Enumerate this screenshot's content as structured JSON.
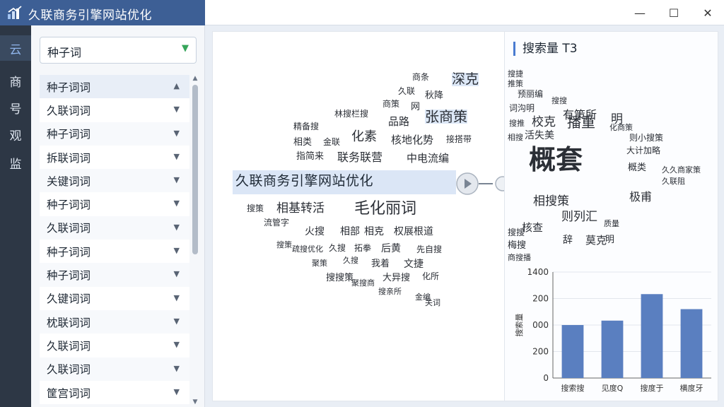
{
  "window": {
    "title": "久联商务引擎网站优化",
    "minimize": "—",
    "maximize": "☐",
    "close": "✕"
  },
  "rail": {
    "items": [
      "云",
      "商",
      "号",
      "观",
      "监"
    ]
  },
  "sidebar": {
    "select_value": "种子词",
    "items": [
      {
        "label": "种子词词",
        "chevron": "up"
      },
      {
        "label": "久联词词",
        "chevron": "down"
      },
      {
        "label": "种子词词",
        "chevron": "down"
      },
      {
        "label": "拆联词词",
        "chevron": "down"
      },
      {
        "label": "关键词词",
        "chevron": "down"
      },
      {
        "label": "种子词词",
        "chevron": "down"
      },
      {
        "label": "久联词词",
        "chevron": "down"
      },
      {
        "label": "种子词词",
        "chevron": "down"
      },
      {
        "label": "种子词词",
        "chevron": "down"
      },
      {
        "label": "久键词词",
        "chevron": "down"
      },
      {
        "label": "枕联词词",
        "chevron": "down"
      },
      {
        "label": "久联词词",
        "chevron": "down"
      },
      {
        "label": "久联词词",
        "chevron": "down"
      },
      {
        "label": "筐宫词词",
        "chevron": "down"
      }
    ]
  },
  "cloud": {
    "main_term": "久联商务引擎网站优化",
    "words": [
      {
        "text": "深克",
        "size": 19,
        "hl": true
      },
      {
        "text": "商条",
        "size": 12
      },
      {
        "text": "久联",
        "size": 12
      },
      {
        "text": "秋降",
        "size": 13
      },
      {
        "text": "商策",
        "size": 12
      },
      {
        "text": "网",
        "size": 13
      },
      {
        "text": "品路",
        "size": 15
      },
      {
        "text": "张商策",
        "size": 20,
        "hl": true
      },
      {
        "text": "林搜栏搜",
        "size": 12
      },
      {
        "text": "精备搜",
        "size": 12
      },
      {
        "text": "化素",
        "size": 18
      },
      {
        "text": "核地化势",
        "size": 15
      },
      {
        "text": "接搭带",
        "size": 12
      },
      {
        "text": "相类",
        "size": 13
      },
      {
        "text": "金联",
        "size": 12
      },
      {
        "text": "指简来",
        "size": 13
      },
      {
        "text": "联务联营",
        "size": 16
      },
      {
        "text": "中电流编",
        "size": 15
      },
      {
        "text": "搜策",
        "size": 12
      },
      {
        "text": "相基转活",
        "size": 17
      },
      {
        "text": "毛化丽词",
        "size": 22
      },
      {
        "text": "流管字",
        "size": 12
      },
      {
        "text": "火搜",
        "size": 14
      },
      {
        "text": "相部",
        "size": 14
      },
      {
        "text": "相克",
        "size": 14
      },
      {
        "text": "权展根道",
        "size": 14
      },
      {
        "text": "搜策",
        "size": 11
      },
      {
        "text": "疏搜优化",
        "size": 11
      },
      {
        "text": "久搜",
        "size": 12
      },
      {
        "text": "拓拳",
        "size": 12
      },
      {
        "text": "后黄",
        "size": 14
      },
      {
        "text": "先自搜",
        "size": 12
      },
      {
        "text": "聚策",
        "size": 11
      },
      {
        "text": "久搜",
        "size": 11
      },
      {
        "text": "我着",
        "size": 13
      },
      {
        "text": "文捷",
        "size": 14
      },
      {
        "text": "搜搜策",
        "size": 13
      },
      {
        "text": "大异搜",
        "size": 13
      },
      {
        "text": "化所",
        "size": 12
      },
      {
        "text": "聚搜商",
        "size": 11
      },
      {
        "text": "搜亲所",
        "size": 11
      },
      {
        "text": "金编",
        "size": 11
      },
      {
        "text": "关词",
        "size": 11
      }
    ]
  },
  "right_panel": {
    "title": "搜索量 T3",
    "cloud": [
      {
        "text": "搜捷",
        "size": 11
      },
      {
        "text": "推策",
        "size": 11
      },
      {
        "text": "预丽编",
        "size": 12
      },
      {
        "text": "搜搜",
        "size": 11
      },
      {
        "text": "词沟明",
        "size": 12
      },
      {
        "text": "有策所",
        "size": 16
      },
      {
        "text": "搜推",
        "size": 11
      },
      {
        "text": "校克",
        "size": 17
      },
      {
        "text": "播重",
        "size": 20
      },
      {
        "text": "明",
        "size": 17
      },
      {
        "text": "化商策",
        "size": 11
      },
      {
        "text": "相搜",
        "size": 11
      },
      {
        "text": "活失美",
        "size": 14
      },
      {
        "text": "则小搜策",
        "size": 12
      },
      {
        "text": "大计加略",
        "size": 12
      },
      {
        "text": "概套",
        "size": 38
      },
      {
        "text": "概类",
        "size": 13
      },
      {
        "text": "久久商家策",
        "size": 11
      },
      {
        "text": "久联阻",
        "size": 11
      },
      {
        "text": "相搜策",
        "size": 17
      },
      {
        "text": "极甫",
        "size": 16
      },
      {
        "text": "则列汇",
        "size": 17
      },
      {
        "text": "核查",
        "size": 15
      },
      {
        "text": "质量",
        "size": 11
      },
      {
        "text": "搜搜",
        "size": 12
      },
      {
        "text": "梅搜",
        "size": 13
      },
      {
        "text": "辞",
        "size": 14
      },
      {
        "text": "莫克",
        "size": 15
      },
      {
        "text": "明",
        "size": 13
      },
      {
        "text": "商搜播",
        "size": 11
      }
    ]
  },
  "colors": {
    "accent": "#3d5f95",
    "bar": "#5a7fc0",
    "highlight": "#dbe6f6"
  },
  "chart_data": {
    "type": "bar",
    "categories": [
      "搜索搜",
      "见度Q",
      "搜度于",
      "横度牙"
    ],
    "values": [
      600,
      650,
      950,
      780
    ],
    "ylabel": "搜索量",
    "ytick_labels": [
      "0",
      "200",
      "000",
      "200",
      "1400"
    ],
    "ylim": [
      0,
      1200
    ],
    "grid": true
  }
}
